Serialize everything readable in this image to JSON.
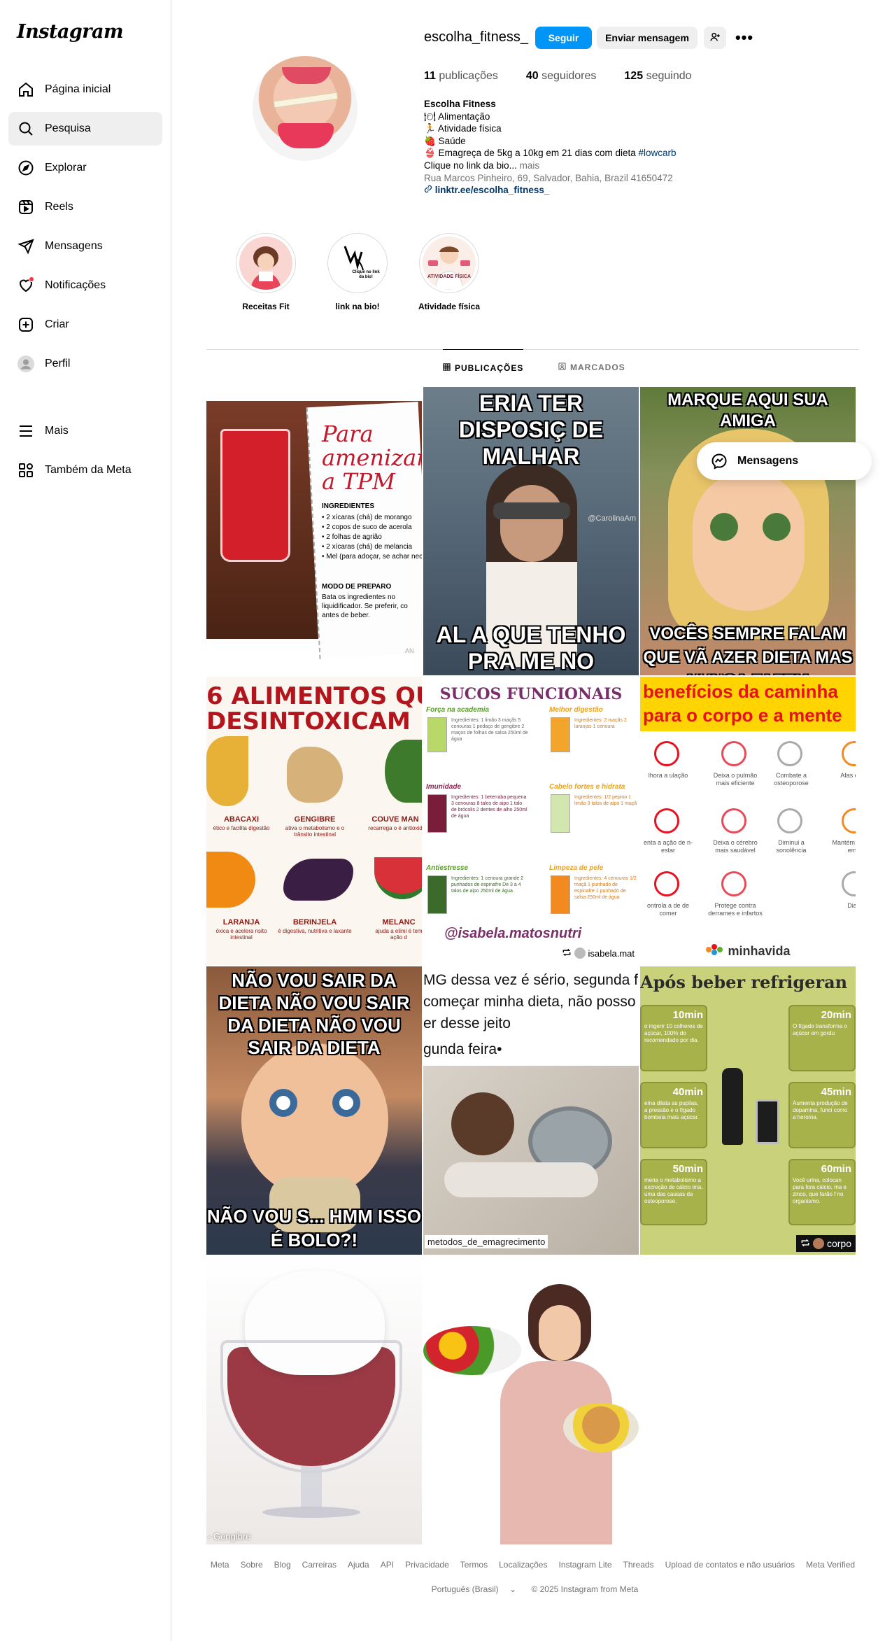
{
  "app": {
    "logo_text": "Instagram"
  },
  "sidebar": {
    "items": [
      {
        "label": "Página inicial",
        "icon": "home-icon"
      },
      {
        "label": "Pesquisa",
        "icon": "search-icon",
        "active": true
      },
      {
        "label": "Explorar",
        "icon": "explore-icon"
      },
      {
        "label": "Reels",
        "icon": "reels-icon"
      },
      {
        "label": "Mensagens",
        "icon": "messages-icon"
      },
      {
        "label": "Notificações",
        "icon": "heart-icon"
      },
      {
        "label": "Criar",
        "icon": "create-icon"
      },
      {
        "label": "Perfil",
        "icon": "profile-avatar"
      }
    ],
    "more_label": "Mais",
    "meta_label": "Também da Meta"
  },
  "profile": {
    "username": "escolha_fitness_",
    "follow_label": "Seguir",
    "message_label": "Enviar mensagem",
    "stats": {
      "posts_count": "11",
      "posts_label": "publicações",
      "followers_count": "40",
      "followers_label": "seguidores",
      "following_count": "125",
      "following_label": "seguindo"
    },
    "bio": {
      "name": "Escolha Fitness",
      "line1": "🍽 Alimentação",
      "line2": "🏃 Atividade física",
      "line3": "🍓 Saúde",
      "line4_text": "👙 Emagreça de 5kg a 10kg em 21 dias com dieta ",
      "line4_hashtag": "#lowcarb",
      "line5_text": "Clique no link da bio...",
      "line5_more": " mais",
      "address": "Rua Marcos Pinheiro, 69, Salvador, Bahia, Brazil 41650472",
      "link": "linktr.ee/escolha_fitness_"
    }
  },
  "highlights": [
    {
      "label": "Receitas Fit"
    },
    {
      "label": "link na bio!",
      "inner_text": "Clique no link da bio!"
    },
    {
      "label": "Atividade física",
      "inner_text": "ATIVIDADE FÍSICA"
    }
  ],
  "tabs": {
    "posts": "PUBLICAÇÕES",
    "tagged": "MARCADOS"
  },
  "posts": {
    "p1": {
      "title": "Para amenizar a TPM",
      "ingredients_title": "INGREDIENTES",
      "ingredients": [
        "• 2 xícaras (chá) de morango",
        "• 2 copos de suco de acerola",
        "• 2 folhas de agrião",
        "• 2 xícaras (chá) de melancia",
        "• Mel (para adoçar, se achar nec"
      ],
      "prep_title": "MODO DE PREPARO",
      "prep_text": "Bata os ingredientes no liquidificador. Se preferir, co antes de beber.",
      "corner": "AN"
    },
    "p2": {
      "top": "ERIA TER DISPOSIÇ DE MALHAR",
      "bottom": "AL A QUE TENHO PRA ME NO CELULAR",
      "watermark": "@CarolinaAm"
    },
    "p3": {
      "top": "MARQUE AQUI SUA AMIGA",
      "bottom": "VOCÊS SEMPRE FALAM QUE VÃ AZER DIETA MAS NUNCA FAZEM"
    },
    "p4": {
      "title_line1": "6 ALIMENTOS QUE",
      "title_line2": "DESINTOXICAM",
      "foods": [
        {
          "name": "ABACAXI",
          "desc": "ético e facilita digestão"
        },
        {
          "name": "GENGIBRE",
          "desc": "ativa o metabolismo e o trânsito intestinal"
        },
        {
          "name": "COUVE MAN",
          "desc": "recarrega o é antioxid"
        },
        {
          "name": "LARANJA",
          "desc": "óxica e acelera nsito intestinal"
        },
        {
          "name": "BERINJELA",
          "desc": "é digestiva, nutritiva e laxante"
        },
        {
          "name": "MELANC",
          "desc": "ajuda a elimi é tem ação d"
        }
      ]
    },
    "p5": {
      "title": "SUCOS FUNCIONAIS",
      "sections": [
        {
          "name": "Força na academia",
          "ingredients": "Ingredientes: 1 limão 3 maçãs 5 cenouras 1 pedaço de gengibre 2 maços de folhas de salsa 250ml de água"
        },
        {
          "name": "Melhor digestão",
          "ingredients": "Ingredientes: 2 maçãs 2 laranjas 1 cenoura"
        },
        {
          "name": "Imunidade",
          "ingredients": "Ingredientes: 1 beterraba pequena 3 cenouras 8 talos de aipo 1 talo de brócolis 2 dentes de alho 250ml de água"
        },
        {
          "name": "Cabelo fortes e hidrata",
          "ingredients": "Ingredientes: 1/2 pepino 1 limão 3 talos de aipo 1 maçã"
        },
        {
          "name": "Antiestresse",
          "ingredients": "Ingredientes: 1 cenoura grande 2 punhados de espinafre De 3 a 4 talos de aipo 250ml de água"
        },
        {
          "name": "Limpeza de pele",
          "ingredients": "Ingredientes: 4 cenouras 1/2 maçã 1 punhado de espinafre 1 punhado de salsa 250ml de água"
        }
      ],
      "signature": "@isabela.matosnutri",
      "repost_user": "isabela.mat"
    },
    "p6": {
      "title_line1": "benefícios da caminha",
      "title_line2": "para o corpo e a mente",
      "benefits": [
        "lhora a ulação",
        "Deixa o pulmão mais eficiente",
        "Combate a osteoporose",
        "Afas depre",
        "enta a ação de n-estar",
        "Deixa o cérebro mais saudável",
        "Diminui a sonolência",
        "Mantém em equi emag",
        "ontrola a de de comer",
        "Protege contra derrames e infartos",
        "Diabe"
      ],
      "brand": "minhavida"
    },
    "p7": {
      "top": "NÃO VOU SAIR DA DIETA NÃO VOU SAIR DA DIETA NÃO VOU SAIR DA DIETA",
      "bottom": "NÃO VOU S... HMM ISSO É BOLO?!"
    },
    "p8": {
      "line1": "MG dessa vez é sério, segunda fei",
      "line2": "começar minha dieta, não posso",
      "line3": "er desse jeito",
      "line4": "gunda feira•",
      "label": "metodos_de_emagrecimento"
    },
    "p9": {
      "title": "Após beber refrigeran",
      "times": [
        {
          "t": "10min",
          "d": "o ingerir 10 colheres de açúcar, 100% do recomendado por dia."
        },
        {
          "t": "20min",
          "d": "O fígado transforma o açúcar em gordu"
        },
        {
          "t": "40min",
          "d": "eína dilata as pupilas, a pressão e o fígado bombeia mais açúcar."
        },
        {
          "t": "45min",
          "d": "Aumenta produção de dopamina, funci como a heroína."
        },
        {
          "t": "50min",
          "d": "meria o metabolismo a excreção de cálcio ima, uma das causas da osteoporose."
        },
        {
          "t": "60min",
          "d": "Você urina, colocan para fora cálcio, ma e zinco, que farão f no organismo."
        }
      ],
      "repost_user": "corpo"
    },
    "p10": {
      "caption": "- Gengibre"
    },
    "p11": {}
  },
  "floating": {
    "messages_label": "Mensagens"
  },
  "footer": {
    "links": [
      "Meta",
      "Sobre",
      "Blog",
      "Carreiras",
      "Ajuda",
      "API",
      "Privacidade",
      "Termos",
      "Localizações",
      "Instagram Lite",
      "Threads",
      "Upload de contatos e não usuários",
      "Meta Verified"
    ],
    "language": "Português (Brasil)",
    "copyright": "© 2025 Instagram from Meta"
  },
  "colors": {
    "primary_blue": "#0095f6",
    "link_blue": "#00376b",
    "secondary_gray": "#737373",
    "notif_red": "#ff3040"
  }
}
